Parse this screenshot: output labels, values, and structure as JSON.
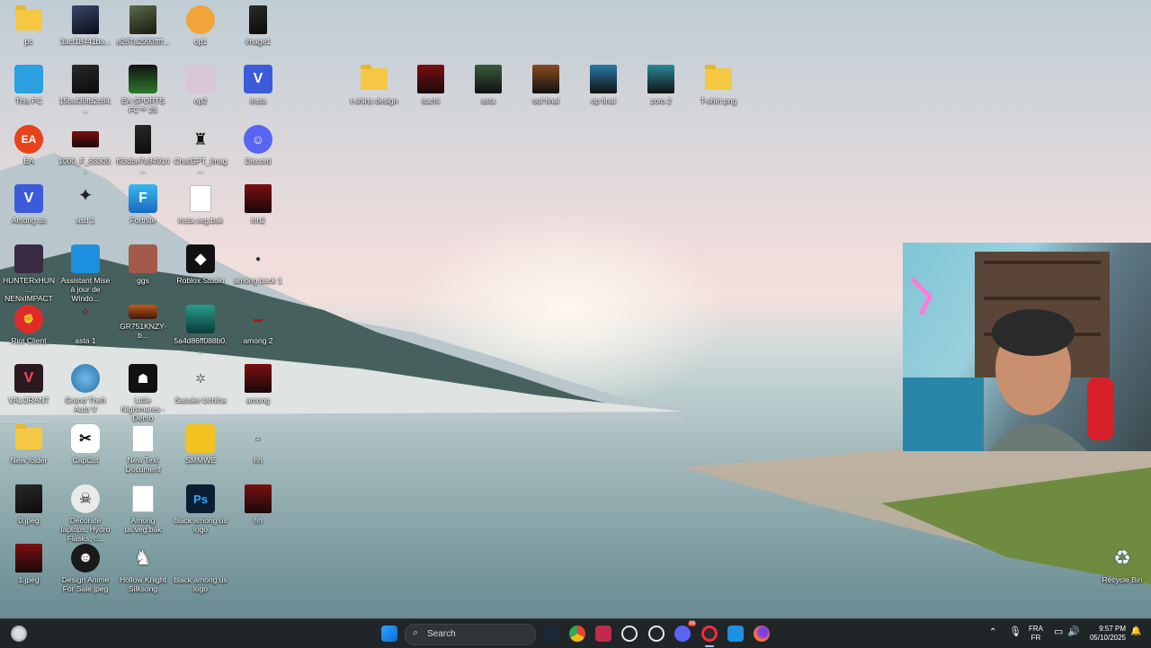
{
  "desktop": {
    "icons": [
      {
        "label": "pc"
      },
      {
        "label": "3acf18441ba..."
      },
      {
        "label": "e267a2993ffff..."
      },
      {
        "label": "op1"
      },
      {
        "label": "image1"
      },
      {
        "label": "This PC"
      },
      {
        "label": "15baf39fb2c84..."
      },
      {
        "label": "EA SPORTS FC™ 25"
      },
      {
        "label": "op2"
      },
      {
        "label": "insta"
      },
      {
        "label": "EA"
      },
      {
        "label": "1000_F_83309..."
      },
      {
        "label": "f93dbe7a84914..."
      },
      {
        "label": "ChatGPT_Imag..."
      },
      {
        "label": "Discord"
      },
      {
        "label": "Among us"
      },
      {
        "label": "asd 1"
      },
      {
        "label": "Fortnite"
      },
      {
        "label": "insta.veg.bak"
      },
      {
        "label": "ihh2"
      },
      {
        "label": "HUNTERxHUN... NENxIMPACT"
      },
      {
        "label": "Assistant Mise à jour de Windo..."
      },
      {
        "label": "ggs"
      },
      {
        "label": "Roblox Studio"
      },
      {
        "label": "among back 1"
      },
      {
        "label": "Riot Client"
      },
      {
        "label": "asta 1"
      },
      {
        "label": "GR751KNZY-b..."
      },
      {
        "label": "5a4d86ff088b0..."
      },
      {
        "label": "among 2"
      },
      {
        "label": "VALORANT"
      },
      {
        "label": "Grand Theft Auto V"
      },
      {
        "label": "Little Nightmares - Demo"
      },
      {
        "label": "Sasuke Uchiha"
      },
      {
        "label": "among"
      },
      {
        "label": "New folder"
      },
      {
        "label": "CapCut"
      },
      {
        "label": "New Text Document"
      },
      {
        "label": "SMMWE"
      },
      {
        "label": "hh"
      },
      {
        "label": "0.jpeg"
      },
      {
        "label": "Decorate laptops, Hydro Flasks, c..."
      },
      {
        "label": "Among us.veg.bak"
      },
      {
        "label": "black among us logo"
      },
      {
        "label": "hh"
      },
      {
        "label": "1.jpeg"
      },
      {
        "label": "Design Anime For Sale.jpeg"
      },
      {
        "label": "Hollow Knight Silksong"
      },
      {
        "label": "black among us logo"
      }
    ],
    "top_row": [
      {
        "label": "t-shirts design"
      },
      {
        "label": "itachi"
      },
      {
        "label": "asta"
      },
      {
        "label": "ouf final"
      },
      {
        "label": "op final"
      },
      {
        "label": "zoro 2"
      },
      {
        "label": "T-shirt png"
      }
    ],
    "recycle_bin": {
      "label": "Recycle Bin"
    }
  },
  "taskbar": {
    "search_placeholder": "Search",
    "language_top": "FRA",
    "language_bottom": "FR",
    "time": "9:57 PM",
    "date": "05/10/2025",
    "discord_badge": "99"
  }
}
